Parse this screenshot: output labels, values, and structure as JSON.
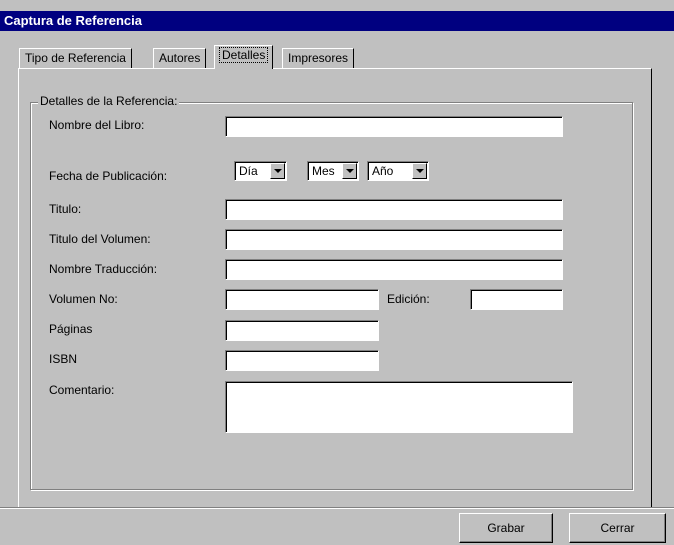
{
  "window": {
    "title": "Captura de Referencia"
  },
  "tabs": [
    {
      "label": "Tipo de Referencia"
    },
    {
      "label": "Autores"
    },
    {
      "label": "Detalles"
    },
    {
      "label": "Impresores"
    }
  ],
  "group": {
    "legend": "Detalles de la Referencia:",
    "fields": {
      "nombre_libro": {
        "label": "Nombre del Libro:",
        "value": ""
      },
      "fecha_publicacion": {
        "label": "Fecha de Publicación:",
        "dia": "Día",
        "mes": "Mes",
        "anio": "Año"
      },
      "titulo": {
        "label": "Titulo:",
        "value": ""
      },
      "titulo_volumen": {
        "label": "Titulo del Volumen:",
        "value": ""
      },
      "nombre_traduccion": {
        "label": "Nombre Traducción:",
        "value": ""
      },
      "volumen_no": {
        "label": "Volumen No:",
        "value": ""
      },
      "edicion": {
        "label": "Edición:",
        "value": ""
      },
      "paginas": {
        "label": "Páginas",
        "value": ""
      },
      "isbn": {
        "label": "ISBN",
        "value": ""
      },
      "comentario": {
        "label": "Comentario:",
        "value": ""
      }
    }
  },
  "buttons": {
    "grabar": "Grabar",
    "cerrar": "Cerrar"
  }
}
